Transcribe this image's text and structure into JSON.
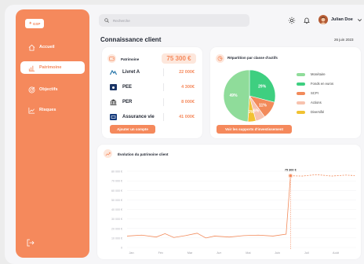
{
  "brand": {
    "logo_text": "GSP"
  },
  "sidebar": {
    "items": [
      {
        "label": "Accueil"
      },
      {
        "label": "Patrimoine"
      },
      {
        "label": "Objectifs"
      },
      {
        "label": "Risques"
      }
    ]
  },
  "topbar": {
    "search_placeholder": "Recherche",
    "user_name": "Julian Doe"
  },
  "page": {
    "title": "Connaissance client",
    "date": "26 juin 2023"
  },
  "patrimoine": {
    "title": "Patrimoine",
    "total": "75 300 €",
    "assets": [
      {
        "name": "Livret A",
        "value": "22 000€"
      },
      {
        "name": "PEE",
        "value": "4 300€"
      },
      {
        "name": "PER",
        "value": "8 000€"
      },
      {
        "name": "Assurance vie",
        "value": "41 000€"
      }
    ],
    "cta": "Ajouter un compte"
  },
  "repartition": {
    "title": "Répartition par classe d'actifs",
    "cta": "Voir les supports d'investissement",
    "slices": [
      {
        "name": "Monétaire",
        "value": 49,
        "label": "49%",
        "color": "#8fdc9a"
      },
      {
        "name": "Fonds en euros",
        "value": 29,
        "label": "29%",
        "color": "#3ecf80"
      },
      {
        "name": "SCPI",
        "value": 11,
        "label": "11%",
        "color": "#f28a5a"
      },
      {
        "name": "Actions",
        "value": 6,
        "label": "6%",
        "color": "#f7c2ae"
      },
      {
        "name": "Diversifié",
        "value": 5,
        "label": "5%",
        "color": "#f1c232"
      }
    ]
  },
  "chart_data": {
    "type": "line",
    "title": "Évolution du patrimoine client",
    "categories": [
      "Jan",
      "Fév",
      "Mar",
      "Avr",
      "Mai",
      "Juin",
      "Juil",
      "Août"
    ],
    "ylim": [
      0,
      80000
    ],
    "y_ticks": [
      "0",
      "10 000 €",
      "20 000 €",
      "30 000 €",
      "40 000 €",
      "50 000 €",
      "60 000 €",
      "70 000 €",
      "80 000 €"
    ],
    "series": [
      {
        "x": [
          0,
          0.5,
          1,
          1.3,
          1.6,
          2.0,
          2.4,
          2.7,
          3.0,
          3.5,
          4.0,
          4.5,
          5.0,
          5.45,
          5.6
        ],
        "values": [
          12000,
          13000,
          11000,
          14500,
          10500,
          12500,
          15000,
          10000,
          12000,
          11000,
          12500,
          13000,
          12000,
          14000,
          75300
        ]
      },
      {
        "x": [
          5.6,
          6.0,
          6.5,
          7.0,
          7.5,
          7.8
        ],
        "values": [
          75300,
          75000,
          76500,
          75000,
          76000,
          75500
        ]
      }
    ],
    "highlight": {
      "x": 5.6,
      "value": 75300,
      "label": "75 300 €"
    }
  },
  "colors": {
    "accent": "#f5895c",
    "accent_light": "#fde7dc"
  }
}
